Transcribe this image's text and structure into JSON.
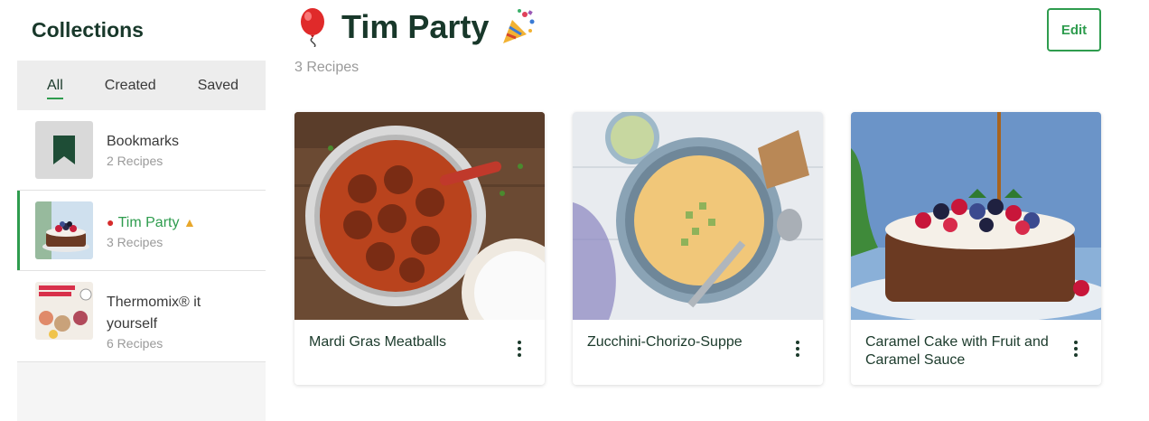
{
  "sidebar": {
    "title": "Collections",
    "tabs": [
      {
        "label": "All",
        "active": true
      },
      {
        "label": "Created",
        "active": false
      },
      {
        "label": "Saved",
        "active": false
      }
    ],
    "items": [
      {
        "name": "Bookmarks",
        "count": "2 Recipes",
        "icon": "bookmark-icon"
      },
      {
        "name": "Tim Party",
        "count": "3 Recipes",
        "active": true
      },
      {
        "name": "Thermomix® it yourself",
        "count": "6 Recipes"
      }
    ]
  },
  "header": {
    "title": "Tim Party",
    "count": "3 Recipes",
    "edit_label": "Edit",
    "leading_icon": "balloon-icon",
    "trailing_icon": "party-popper-icon"
  },
  "recipes": [
    {
      "title": "Mardi Gras Meatballs"
    },
    {
      "title": "Zucchini-Chorizo-Suppe"
    },
    {
      "title": "Caramel Cake with Fruit and Caramel Sauce"
    }
  ],
  "colors": {
    "accent": "#2e9c4e",
    "heading": "#18382a",
    "muted": "#9a9a9a"
  }
}
